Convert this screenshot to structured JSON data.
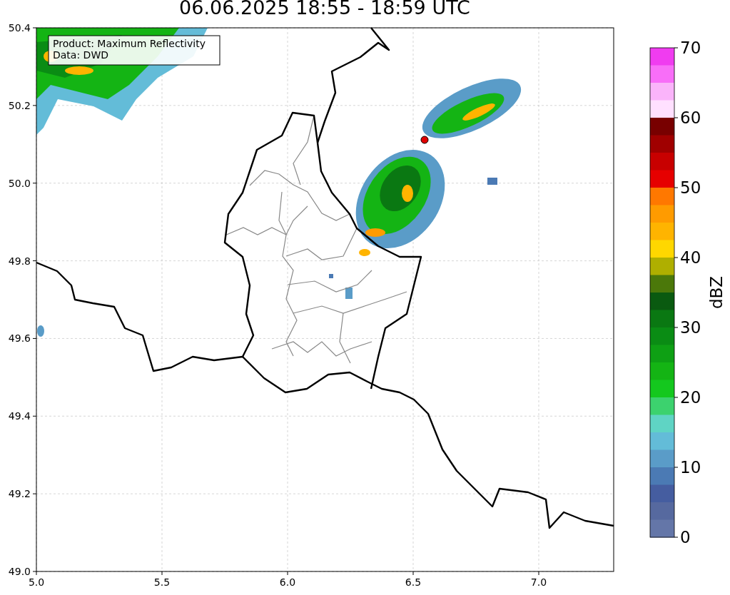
{
  "title": "06.06.2025 18:55 - 18:59 UTC",
  "map": {
    "info_box": [
      "Product: Maximum Reflectivity",
      "Data: DWD"
    ],
    "xticks": [
      "5.0",
      "5.5",
      "6.0",
      "6.5",
      "7.0"
    ],
    "yticks": [
      "50.4",
      "50.2",
      "50.0",
      "49.8",
      "49.6",
      "49.4",
      "49.2",
      "49.0"
    ]
  },
  "colorbar": {
    "label": "dBZ",
    "ticks": [
      "70",
      "60",
      "50",
      "40",
      "30",
      "20",
      "10",
      "0"
    ],
    "bins": [
      {
        "color": "#f03cf0"
      },
      {
        "color": "#f86ef8"
      },
      {
        "color": "#fab4fa"
      },
      {
        "color": "#ffe0ff"
      },
      {
        "color": "#780000"
      },
      {
        "color": "#a00000"
      },
      {
        "color": "#c80000"
      },
      {
        "color": "#e60000"
      },
      {
        "color": "#ff7800"
      },
      {
        "color": "#ff9b00"
      },
      {
        "color": "#ffb400"
      },
      {
        "color": "#ffd700"
      },
      {
        "color": "#afaf00"
      },
      {
        "color": "#4b780a"
      },
      {
        "color": "#0a5a10"
      },
      {
        "color": "#0a7812"
      },
      {
        "color": "#0a8c14"
      },
      {
        "color": "#0ea014"
      },
      {
        "color": "#14b414"
      },
      {
        "color": "#14c81e"
      },
      {
        "color": "#3cd26e"
      },
      {
        "color": "#5fd4c4"
      },
      {
        "color": "#63bcd8"
      },
      {
        "color": "#5a9cc8"
      },
      {
        "color": "#4b7ab4"
      },
      {
        "color": "#455da0"
      },
      {
        "color": "#56699f"
      },
      {
        "color": "#6476a8"
      }
    ]
  }
}
